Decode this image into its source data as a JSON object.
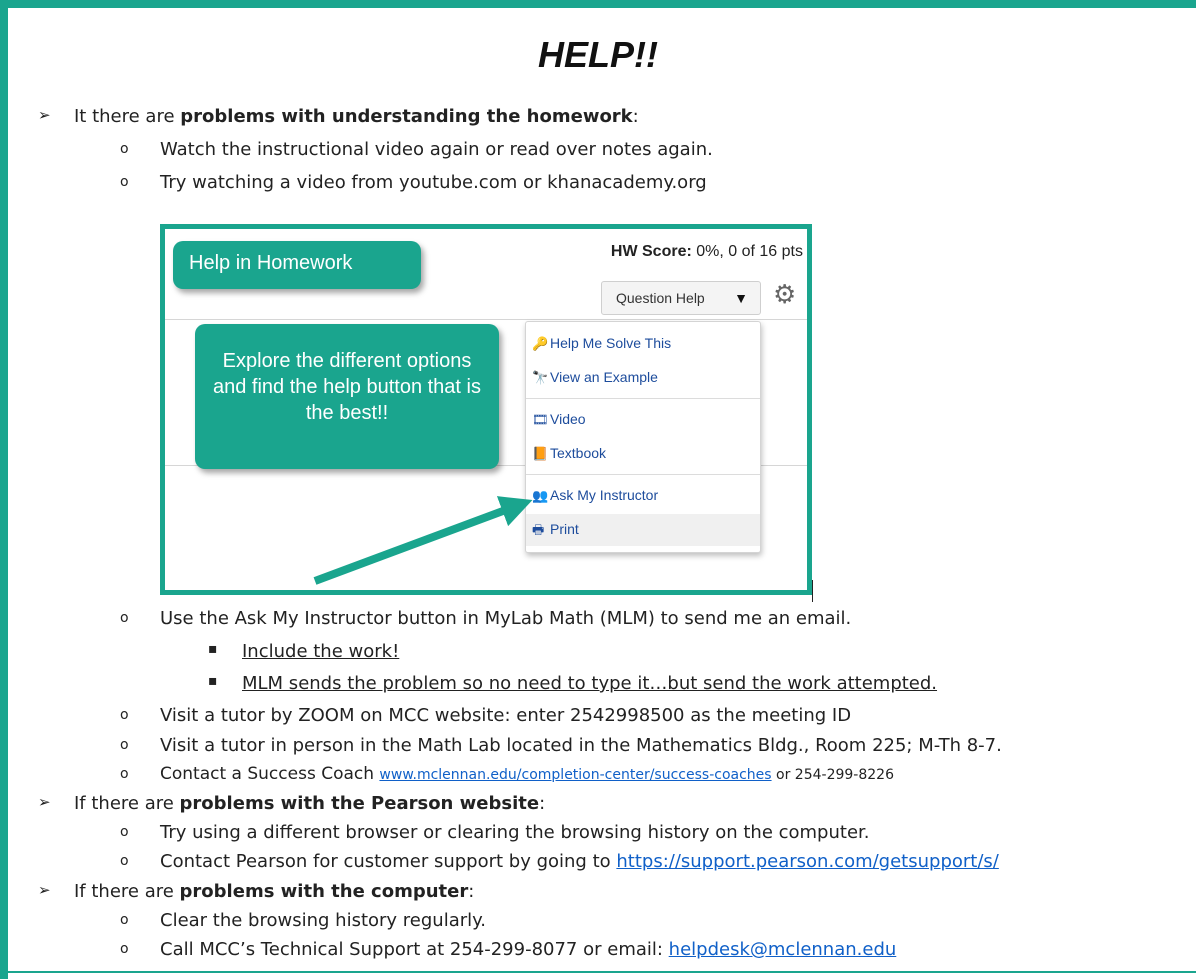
{
  "title": "HELP!!",
  "colors": {
    "accent": "#1aa58e",
    "link": "#1060c8",
    "menu_link": "#1d4c9c"
  },
  "sections": [
    {
      "bullet": "➢",
      "prefix": "It there are ",
      "bold": "problems with understanding the homework",
      "suffix": ":",
      "items": [
        "Watch the instructional video again or read over notes again.",
        "Try watching a video from youtube.com or khanacademy.org"
      ]
    }
  ],
  "screenshot": {
    "callout_help": "Help in Homework",
    "hw_score_label": "HW Score:",
    "hw_score_value": " 0%, 0 of 16 pts",
    "question_help": "Question Help",
    "callout_explore": "Explore the different options and find the help button that is the best!!",
    "menu": [
      {
        "icon": "key-icon",
        "glyph": "🔑",
        "label": "Help Me Solve This"
      },
      {
        "icon": "binoculars-icon",
        "glyph": "🔭",
        "label": "View an Example"
      },
      {
        "icon": "film-icon",
        "glyph": "🎞",
        "label": "Video"
      },
      {
        "icon": "book-icon",
        "glyph": "📙",
        "label": "Textbook"
      },
      {
        "icon": "instructor-icon",
        "glyph": "👥",
        "label": "Ask My Instructor"
      },
      {
        "icon": "printer-icon",
        "glyph": "🖶",
        "label": "Print"
      }
    ]
  },
  "after_shot": {
    "ask_item": "Use the Ask My Instructor button in MyLab Math (MLM) to send me an email.",
    "sub_items": [
      "Include the work!",
      "MLM sends the problem so no need to type it…but send the work attempted."
    ],
    "zoom_item": "Visit a tutor by ZOOM on MCC website:  enter 2542998500 as the meeting ID",
    "lab_item": "Visit a tutor in person in the Math Lab located in the Mathematics Bldg., Room 225; M-Th 8-7.",
    "coach_prefix": "Contact a Success Coach ",
    "coach_link": "www.mclennan.edu/completion-center/success-coaches",
    "coach_suffix": "  or 254-299-8226"
  },
  "pearson": {
    "prefix": "If there are ",
    "bold": "problems with the Pearson website",
    "suffix": ":",
    "item1": "Try using a different browser or clearing the browsing history on the computer.",
    "item2_prefix": "Contact Pearson for customer support by going to ",
    "item2_link": "https://support.pearson.com/getsupport/s/"
  },
  "computer": {
    "prefix": "If there are ",
    "bold": "problems with the computer",
    "suffix": ":",
    "item1": "Clear the browsing history regularly.",
    "item2_prefix": "Call MCC’s Technical Support at 254-299-8077 or email: ",
    "item2_link": "helpdesk@mclennan.edu"
  },
  "markers": {
    "l1": "➢",
    "l2": "o",
    "l3": "▪"
  }
}
